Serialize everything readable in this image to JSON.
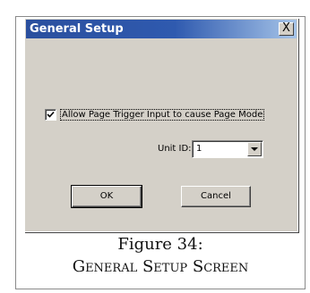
{
  "dialog": {
    "title": "General Setup",
    "close_label": "X",
    "checkbox_label": "Allow Page Trigger Input to cause Page Mode",
    "checkbox_checked": true,
    "unit_id_label": "Unit ID:",
    "unit_id_value": "1",
    "ok_label": "OK",
    "cancel_label": "Cancel"
  },
  "caption": {
    "figure": "Figure 34:",
    "title": "General Setup Screen"
  },
  "colors": {
    "titlebar_start": "#2a4f9e",
    "titlebar_end": "#a6c4e8",
    "dialog_face": "#d4d0c8"
  },
  "icons": {
    "close": "close-icon",
    "check": "checkmark-icon",
    "dropdown": "chevron-down-icon"
  }
}
